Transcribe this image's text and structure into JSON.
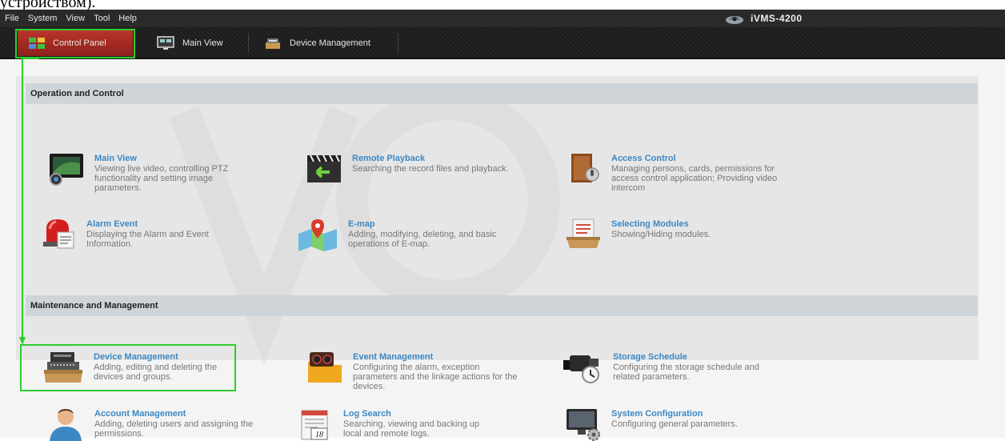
{
  "cut_text": "устройством).",
  "menu": [
    "File",
    "System",
    "View",
    "Tool",
    "Help"
  ],
  "app_title": "iVMS-4200",
  "tabs": [
    {
      "label": "Control Panel",
      "icon": "control-panel-icon"
    },
    {
      "label": "Main View",
      "icon": "main-view-icon"
    },
    {
      "label": "Device Management",
      "icon": "device-management-icon"
    }
  ],
  "sections": {
    "operation": "Operation and Control",
    "maintenance": "Maintenance and Management"
  },
  "modules": {
    "main_view": {
      "title": "Main View",
      "desc": "Viewing live video, controlling PTZ functionality and setting image parameters.",
      "icon": "monitor-icon"
    },
    "remote_playback": {
      "title": "Remote Playback",
      "desc": "Searching the record files and playback.",
      "icon": "clapperboard-icon"
    },
    "access_control": {
      "title": "Access Control",
      "desc": "Managing persons, cards, permissions for access control application; Providing video intercom",
      "icon": "door-icon"
    },
    "alarm_event": {
      "title": "Alarm Event",
      "desc": "Displaying the Alarm and Event Information.",
      "icon": "siren-icon"
    },
    "emap": {
      "title": "E-map",
      "desc": "Adding, modifying, deleting, and basic operations of E-map.",
      "icon": "map-icon"
    },
    "selecting_modules": {
      "title": "Selecting Modules",
      "desc": "Showing/Hiding modules.",
      "icon": "tray-icon"
    },
    "device_management": {
      "title": "Device Management",
      "desc": "Adding, editing and deleting the devices and groups.",
      "icon": "device-icon"
    },
    "event_management": {
      "title": "Event Management",
      "desc": "Configuring the alarm, exception parameters and the linkage actions for the devices.",
      "icon": "folder-camera-icon"
    },
    "storage_schedule": {
      "title": "Storage Schedule",
      "desc": "Configuring the storage schedule and related parameters.",
      "icon": "camera-clock-icon"
    },
    "account_management": {
      "title": "Account Management",
      "desc": "Adding, deleting users and assigning the permissions.",
      "icon": "user-icon"
    },
    "log_search": {
      "title": "Log Search",
      "desc": "Searching, viewing and backing up local and remote logs.",
      "icon": "calendar-icon",
      "calendar_day": "18"
    },
    "system_configuration": {
      "title": "System Configuration",
      "desc": "Configuring general parameters.",
      "icon": "monitor-gear-icon"
    }
  },
  "colors": {
    "accent": "#3b88c4",
    "highlight": "#2ecc2e",
    "active_tab": "#a32a22"
  }
}
